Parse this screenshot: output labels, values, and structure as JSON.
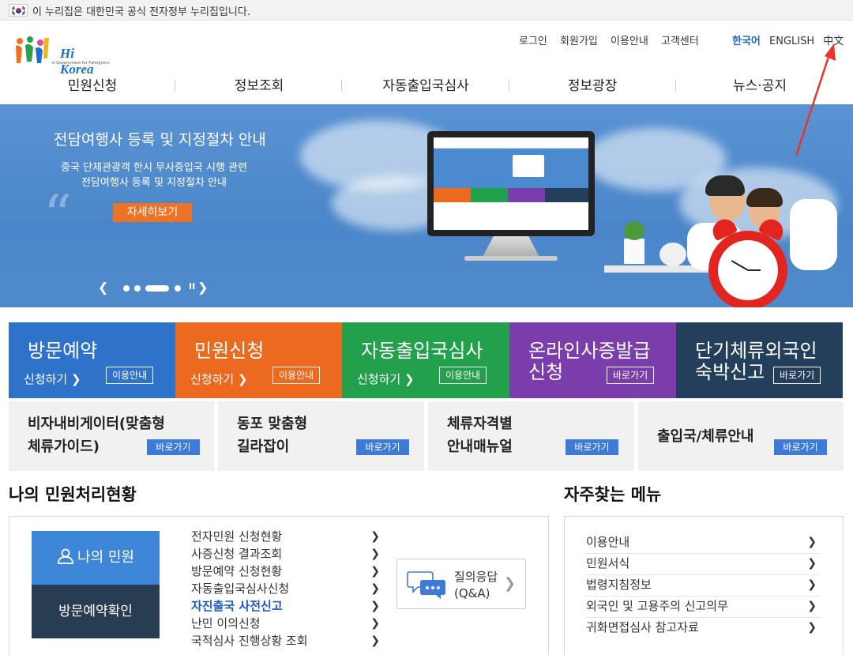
{
  "gov_banner": {
    "text": "이 누리집은 대한민국 공식 전자정부 누리집입니다."
  },
  "logo": {
    "text": "Hi Korea",
    "sub": "e-Government for Foreigners"
  },
  "util_nav": [
    "로그인",
    "회원가입",
    "이용안내",
    "고객센터"
  ],
  "lang_nav": {
    "items": [
      "한국어",
      "ENGLISH",
      "中文"
    ],
    "active": "한국어"
  },
  "main_nav": [
    "민원신청",
    "정보조회",
    "자동출입국심사",
    "정보광장",
    "뉴스·공지"
  ],
  "hero": {
    "title": "전담여행사 등록 및 지정절차 안내",
    "desc_line1": "중국 단체관광객 한시 무사증입국 시행 관련",
    "desc_line2": "전담여행사 등록 및 지정절차 안내",
    "button": "자세히보기"
  },
  "service_tiles": [
    {
      "title": "방문예약",
      "sub": "신청하기 ❯",
      "btn": "이용안내",
      "color": "#2e72c9"
    },
    {
      "title": "민원신청",
      "sub": "신청하기 ❯",
      "btn": "이용안내",
      "color": "#ec6a1f"
    },
    {
      "title": "자동출입국심사",
      "sub": "신청하기 ❯",
      "btn": "이용안내",
      "color": "#22a04b"
    },
    {
      "title1": "온라인사증발급",
      "title2": "신청",
      "btn": "바로가기",
      "color": "#7a3dab"
    },
    {
      "title1": "단기체류외국인",
      "title2": "숙박신고",
      "btn": "바로가기",
      "color": "#233f5c"
    }
  ],
  "quick_links": [
    {
      "line1": "비자내비게이터(맞춤형",
      "line2": "체류가이드)",
      "btn": "바로가기"
    },
    {
      "line1": "동포 맞춤형",
      "line2": "길라잡이",
      "btn": "바로가기"
    },
    {
      "line1": "체류자격별",
      "line2": "안내매뉴얼",
      "btn": "바로가기"
    },
    {
      "line1": "출입국/체류안내",
      "btn": "바로가기"
    }
  ],
  "my_civil": {
    "title": "나의 민원처리현황",
    "my_civil_label": "나의 민원",
    "visit_check_label": "방문예약확인",
    "items": [
      "전자민원 신청현황",
      "사증신청 결과조회",
      "방문예약 신청현황",
      "자동출입국심사신청",
      "자진출국 사전신고",
      "난민 이의신청",
      "국적심사 진행상황 조회"
    ],
    "highlight": "자진출국 사전신고",
    "qa_line1": "질의응답",
    "qa_line2": "(Q&A)"
  },
  "freq_menu": {
    "title": "자주찾는 메뉴",
    "items": [
      "이용안내",
      "민원서식",
      "법령지침정보",
      "외국인 및 고용주의 신고의무",
      "귀화면접심사 참고자료"
    ]
  },
  "colors": {
    "accent": "#3d7bd6",
    "hero_bg": "#4a86c9",
    "annotation": "#e8362a"
  },
  "icons": [
    "korean-flag-icon",
    "user-icon",
    "chat-bubble-icon",
    "chevron-right-icon",
    "red-annotation-arrow"
  ]
}
